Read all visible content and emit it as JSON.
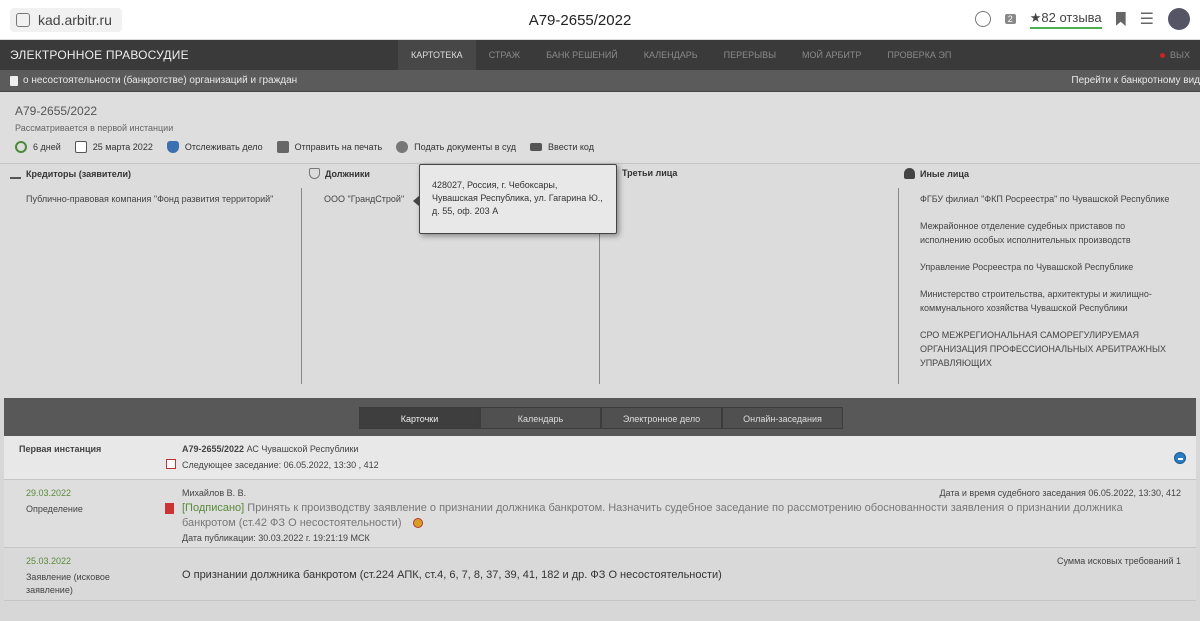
{
  "browser": {
    "url": "kad.arbitr.ru",
    "tab_title": "А79-2655/2022",
    "reviews": "★82 отзыва",
    "badge": "2"
  },
  "topnav": {
    "brand": "ЭЛЕКТРОННОЕ ПРАВОСУДИЕ",
    "items": [
      "КАРТОТЕКА",
      "СТРАЖ",
      "БАНК РЕШЕНИЙ",
      "КАЛЕНДАРЬ",
      "ПЕРЕРЫВЫ",
      "МОЙ АРБИТР",
      "ПРОВЕРКА ЭП"
    ],
    "exit": "ВЫХ"
  },
  "subnav": {
    "left": "о несостоятельности (банкротстве) организаций и граждан",
    "right": "Перейти к банкротному вид"
  },
  "case": {
    "number": "А79-2655/2022",
    "status": "Рассматривается в первой инстанции",
    "toolbar": {
      "days": "6 дней",
      "date": "25 марта 2022",
      "track": "Отслеживать дело",
      "print": "Отправить на печать",
      "submit": "Подать документы в суд",
      "code": "Ввести код"
    }
  },
  "parties": {
    "creditors_title": "Кредиторы (заявители)",
    "creditors": [
      "Публично-правовая компания \"Фонд развития территорий\""
    ],
    "debtors_title": "Должники",
    "debtors": [
      "ООО \"ГрандСтрой\""
    ],
    "third_title": "Третьи лица",
    "others_title": "Иные лица",
    "others": [
      "ФГБУ филиал \"ФКП Росреестра\" по Чувашской Республике",
      "Межрайонное отделение судебных приставов по исполнению особых исполнительных производств",
      "Управление Росреестра по Чувашской Республике",
      "Министерство строительства, архитектуры и жилищно-коммунального хозяйства Чувашской Республики",
      "СРО МЕЖРЕГИОНАЛЬНАЯ САМОРЕГУЛИРУЕМАЯ ОРГАНИЗАЦИЯ ПРОФЕССИОНАЛЬНЫХ АРБИТРАЖНЫХ УПРАВЛЯЮЩИХ"
    ],
    "tooltip": "428027, Россия, г. Чебоксары, Чувашская Республика, ул. Гагарина Ю., д. 55, оф. 203 А"
  },
  "tabs": [
    "Карточки",
    "Календарь",
    "Электронное дело",
    "Онлайн-заседания"
  ],
  "instance": {
    "label": "Первая инстанция",
    "case_ref": "А79-2655/2022",
    "court": "АС Чувашской Республики",
    "next": "Следующее заседание: 06.05.2022, 13:30 , 412"
  },
  "entries": [
    {
      "date": "29.03.2022",
      "type": "Определение",
      "judge": "Михайлов В. В.",
      "right": "Дата и время судебного заседания 06.05.2022, 13:30, 412",
      "signed": "[Подписано]",
      "text1": "Принять к производству заявление о признании должника банкротом. Назначить судебное заседание по рассмотрению обоснованности заявления о признании должника",
      "text2": "банкротом (ст.42 ФЗ О несостоятельности)",
      "pub": "Дата публикации: 30.03.2022 г. 19:21:19 МСК"
    },
    {
      "date": "25.03.2022",
      "type1": "Заявление (исковое",
      "type2": "заявление)",
      "right": "Сумма исковых требований 1",
      "text": "О признании должника банкротом (ст.224 АПК, ст.4, 6, 7, 8, 37, 39, 41, 182 и др. ФЗ О несостоятельности)"
    }
  ]
}
